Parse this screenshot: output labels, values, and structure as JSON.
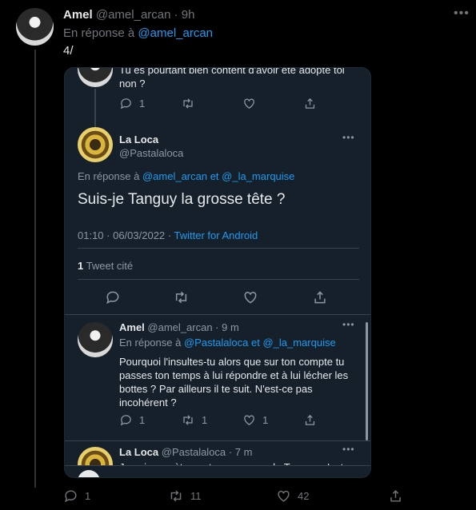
{
  "tweet": {
    "author_name": "Amel",
    "author_handle": "@amel_arcan",
    "time": "· 9h",
    "reply_prefix": "En réponse à",
    "reply_to": "@amel_arcan",
    "text": "4/",
    "actions": {
      "reply_count": "1",
      "retweet_count": "11",
      "like_count": "42"
    }
  },
  "embed": {
    "top_snippet": {
      "line1": "Tu es pourtant bien content d'avoir été adopté toi",
      "line2": "non ?",
      "reply_count": "1"
    },
    "main": {
      "author_name": "La Loca",
      "author_handle": "@Pastalaloca",
      "reply_prefix": "En réponse à",
      "reply_to": "@amel_arcan et @_la_marquise",
      "text": "Suis-je Tanguy la grosse tête ?",
      "timestamp": "01:10 · 06/03/2022 ·",
      "source": "Twitter for Android",
      "quote_count": "1",
      "quote_label": "Tweet cité"
    },
    "reply": {
      "author_name": "Amel",
      "author_handle": "@amel_arcan",
      "time": "· 9 m",
      "reply_prefix": "En réponse à",
      "reply_to": "@Pastalaloca et @_la_marquise",
      "line1": "Pourquoi l'insultes-tu alors que sur ton compte tu",
      "line2": "passes ton temps à lui répondre et à lui lécher les",
      "line3": "bottes ? Par ailleurs il te suit. N'est-ce pas",
      "line4": "incohérent ?",
      "reply_count": "1",
      "retweet_count": "1",
      "like_count": "1"
    },
    "next": {
      "author_name": "La Loca",
      "author_handle": "@Pastalaloca",
      "time": "· 7 m",
      "text": "Je suis secrètement amoureuse de Tanguy, c'est"
    }
  },
  "colors": {
    "background": "#000000",
    "card": "#15202b",
    "link": "#1d9bf0",
    "muted": "#71767b"
  }
}
